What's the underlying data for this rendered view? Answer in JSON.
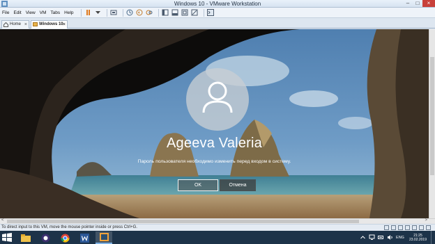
{
  "window": {
    "title": "Windows 10 - VMware Workstation"
  },
  "menu": [
    "File",
    "Edit",
    "View",
    "VM",
    "Tabs",
    "Help"
  ],
  "tabs": [
    {
      "label": "Home"
    },
    {
      "label": "Windows 10"
    }
  ],
  "lock_screen": {
    "username": "Ageeva Valeria",
    "message": "Пароль пользователя необходимо изменить перед входом в систему.",
    "ok_label": "OK",
    "cancel_label": "Отмена"
  },
  "status": {
    "hint": "To direct input to this VM, move the mouse pointer inside or press Ctrl+G."
  },
  "tray": {
    "lang": "ENG",
    "time": "21:25",
    "date": "23.02.2019"
  }
}
